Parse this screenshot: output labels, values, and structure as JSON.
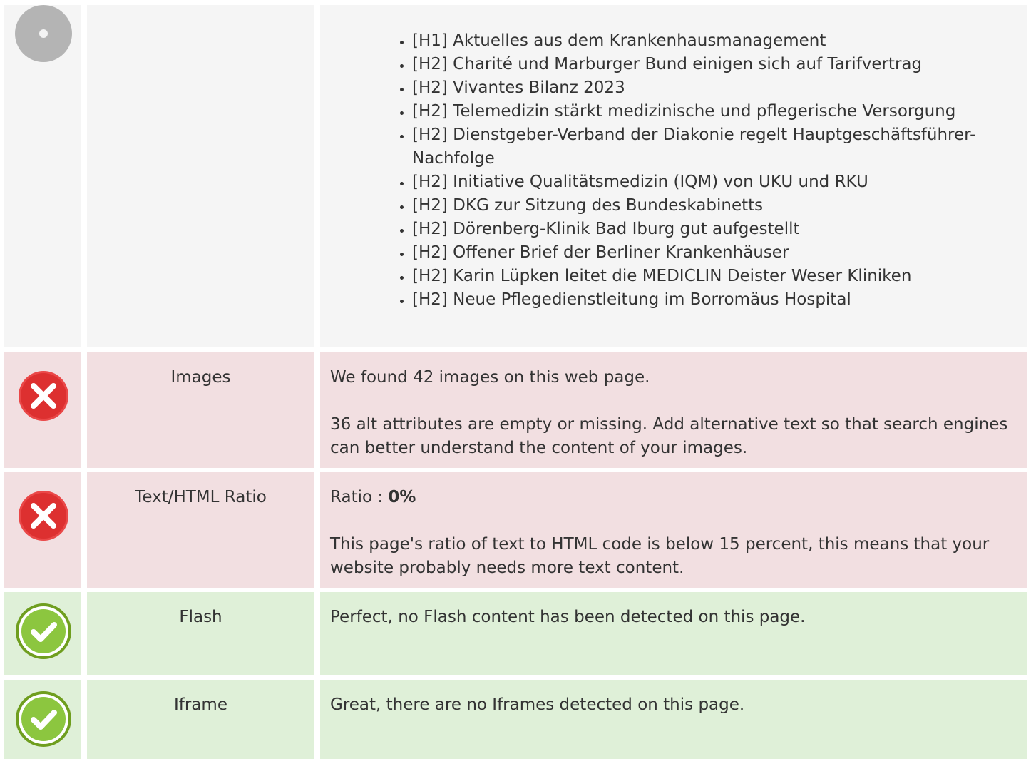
{
  "headings": {
    "items": [
      "[H1] Aktuelles aus dem Krankenhausmanagement",
      "[H2] Charité und Marburger Bund einigen sich auf Tarifvertrag",
      "[H2] Vivantes Bilanz 2023",
      "[H2] Telemedizin stärkt medizinische und pflegerische Versorgung",
      "[H2] Dienstgeber-Verband der Diakonie regelt Hauptgeschäftsführer-Nachfolge",
      "[H2] Initiative Qualitätsmedizin (IQM) von UKU und RKU",
      "[H2] DKG zur Sitzung des Bundeskabinetts",
      "[H2] Dörenberg-Klinik Bad Iburg gut aufgestellt",
      "[H2] Offener Brief der Berliner Krankenhäuser",
      "[H2] Karin Lüpken leitet die MEDICLIN Deister Weser Kliniken",
      "[H2] Neue Pflegedienstleitung im Borromäus Hospital"
    ]
  },
  "images": {
    "status": "error",
    "icon": "error-x-icon",
    "label": "Images",
    "line1": "We found 42 images on this web page.",
    "line2": "36 alt attributes are empty or missing. Add alternative text so that search engines can better understand the content of your images."
  },
  "text_html_ratio": {
    "status": "error",
    "icon": "error-x-icon",
    "label": "Text/HTML Ratio",
    "ratio_label": "Ratio : ",
    "ratio_value": "0%",
    "description": "This page's ratio of text to HTML code is below 15 percent, this means that your website probably needs more text content."
  },
  "flash": {
    "status": "ok",
    "icon": "check-icon",
    "label": "Flash",
    "message": "Perfect, no Flash content has been detected on this page."
  },
  "iframe": {
    "status": "ok",
    "icon": "check-icon",
    "label": "Iframe",
    "message": "Great, there are no Iframes detected on this page."
  },
  "colors": {
    "error_bg": "#f2dfe1",
    "ok_bg": "#dff0d8",
    "neutral_bg": "#f5f5f5",
    "error_icon": "#e53a3a",
    "ok_icon": "#8cc63f"
  }
}
